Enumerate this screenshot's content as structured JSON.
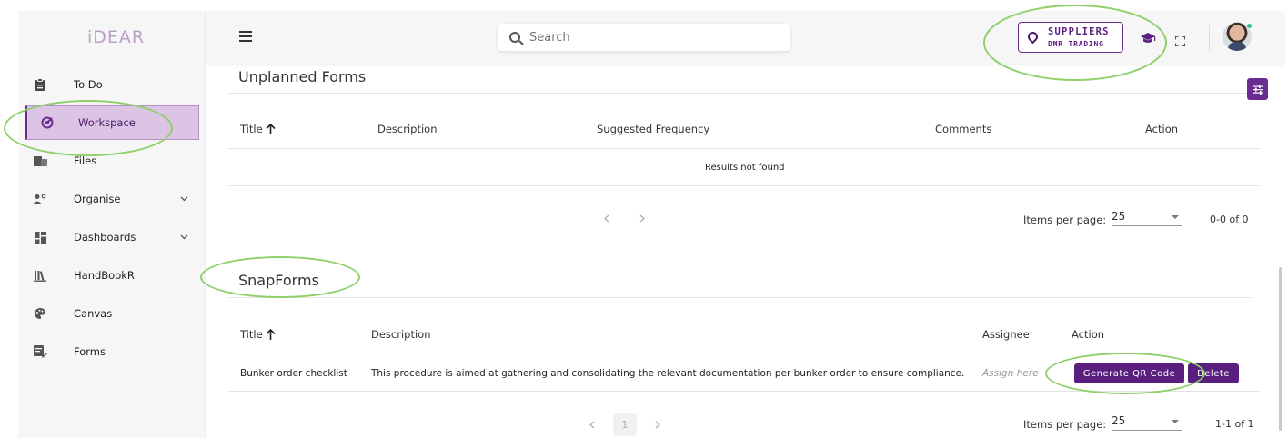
{
  "logo": {
    "text": "iDEAR"
  },
  "sidebar": {
    "items": [
      {
        "label": "To Do",
        "icon": "clipboard-icon"
      },
      {
        "label": "Workspace",
        "icon": "target-icon",
        "active": true
      },
      {
        "label": "Files",
        "icon": "folder-icon"
      },
      {
        "label": "Organise",
        "icon": "people-icon",
        "expandable": true
      },
      {
        "label": "Dashboards",
        "icon": "dashboard-icon",
        "expandable": true
      },
      {
        "label": "HandBookR",
        "icon": "books-icon"
      },
      {
        "label": "Canvas",
        "icon": "palette-icon"
      },
      {
        "label": "Forms",
        "icon": "form-icon"
      }
    ]
  },
  "topbar": {
    "search_placeholder": "Search",
    "supplier_title": "SUPPLIERS",
    "supplier_subtitle": "DMR TRADING"
  },
  "unplanned": {
    "title": "Unplanned Forms",
    "columns": [
      "Title",
      "Description",
      "Suggested Frequency",
      "Comments",
      "Action"
    ],
    "empty_text": "Results not found",
    "items_per_page_label": "Items per page:",
    "items_per_page": "25",
    "count": "0-0 of 0"
  },
  "snapforms": {
    "title": "SnapForms",
    "columns": [
      "Title",
      "Description",
      "Assignee",
      "Action"
    ],
    "rows": [
      {
        "title": "Bunker order checklist",
        "description": "This procedure is aimed at gathering and consolidating the relevant documentation per bunker order to ensure compliance.",
        "assignee": "Assign here",
        "qr_label": "Generate QR Code",
        "delete_label": "Delete"
      }
    ],
    "page": "1",
    "items_per_page_label": "Items per page:",
    "items_per_page": "25",
    "count": "1-1 of 1"
  },
  "colors": {
    "accent": "#5a1f7e",
    "active_bg": "#dcc4e4",
    "annotation": "#8ed06a"
  }
}
